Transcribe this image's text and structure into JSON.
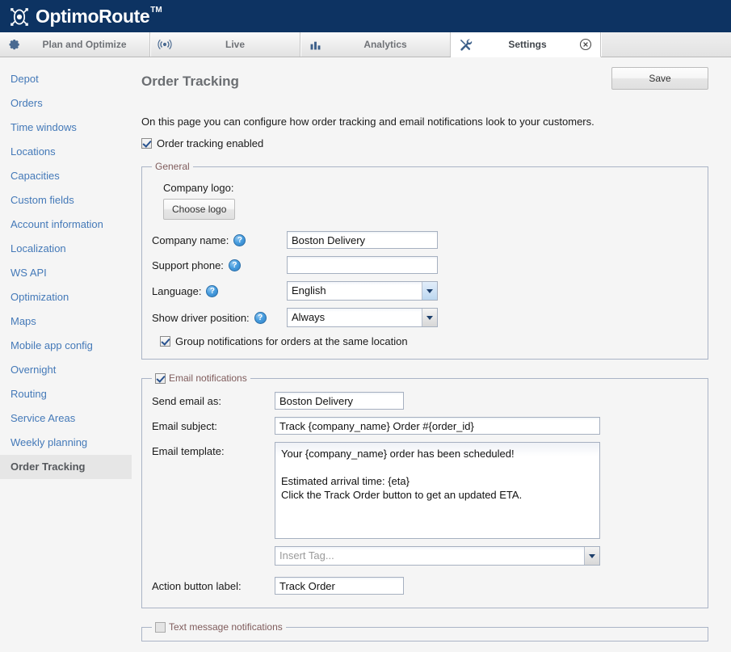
{
  "brand": {
    "name": "OptimoRoute",
    "tm": "TM",
    "logo_icon": "optimoroute-logo-icon",
    "bar_color": "#0d3362"
  },
  "tabs": [
    {
      "id": "plan",
      "label": "Plan and Optimize",
      "icon": "gear-icon",
      "active": false
    },
    {
      "id": "live",
      "label": "Live",
      "icon": "broadcast-icon",
      "active": false
    },
    {
      "id": "analytics",
      "label": "Analytics",
      "icon": "bar-chart-icon",
      "active": false
    },
    {
      "id": "settings",
      "label": "Settings",
      "icon": "tools-icon",
      "active": true,
      "close_icon": "close-circle-icon"
    }
  ],
  "sidebar": {
    "items": [
      {
        "label": "Depot",
        "active": false
      },
      {
        "label": "Orders",
        "active": false
      },
      {
        "label": "Time windows",
        "active": false
      },
      {
        "label": "Locations",
        "active": false
      },
      {
        "label": "Capacities",
        "active": false
      },
      {
        "label": "Custom fields",
        "active": false
      },
      {
        "label": "Account information",
        "active": false
      },
      {
        "label": "Localization",
        "active": false
      },
      {
        "label": "WS API",
        "active": false
      },
      {
        "label": "Optimization",
        "active": false
      },
      {
        "label": "Maps",
        "active": false
      },
      {
        "label": "Mobile app config",
        "active": false
      },
      {
        "label": "Overnight",
        "active": false
      },
      {
        "label": "Routing",
        "active": false
      },
      {
        "label": "Service Areas",
        "active": false
      },
      {
        "label": "Weekly planning",
        "active": false
      },
      {
        "label": "Order Tracking",
        "active": true
      }
    ],
    "link_color": "#4479b8",
    "active_bg": "#e6e6e6"
  },
  "main": {
    "title": "Order Tracking",
    "save_label": "Save",
    "description": "On this page you can configure how order tracking and email notifications look to your customers.",
    "enabled_checkbox": {
      "label": "Order tracking enabled",
      "checked": true
    }
  },
  "general": {
    "legend": "General",
    "company_logo_label": "Company logo:",
    "choose_logo_label": "Choose logo",
    "company_name_label": "Company name:",
    "company_name_value": "Boston Delivery",
    "support_phone_label": "Support phone:",
    "support_phone_value": "",
    "language_label": "Language:",
    "language_value": "English",
    "driver_position_label": "Show driver position:",
    "driver_position_value": "Always",
    "group_notifications": {
      "label": "Group notifications for orders at the same location",
      "checked": true
    },
    "help_icon": "help-circle-icon"
  },
  "email": {
    "legend": "Email notifications",
    "legend_checked": true,
    "send_as_label": "Send email as:",
    "send_as_value": "Boston Delivery",
    "subject_label": "Email subject:",
    "subject_value": "Track {company_name} Order #{order_id}",
    "template_label": "Email template:",
    "template_value": "Your {company_name} order has been scheduled!\n\nEstimated arrival time: {eta}\nClick the Track Order button to get an updated ETA.",
    "insert_tag_placeholder": "Insert Tag...",
    "action_label": "Action button label:",
    "action_value": "Track Order"
  },
  "sms": {
    "legend": "Text message notifications",
    "legend_checked": false
  },
  "colors": {
    "legend_text": "#7f5c5c",
    "fieldset_border": "#aab4c6",
    "help_blue": "#4a9fe0"
  }
}
